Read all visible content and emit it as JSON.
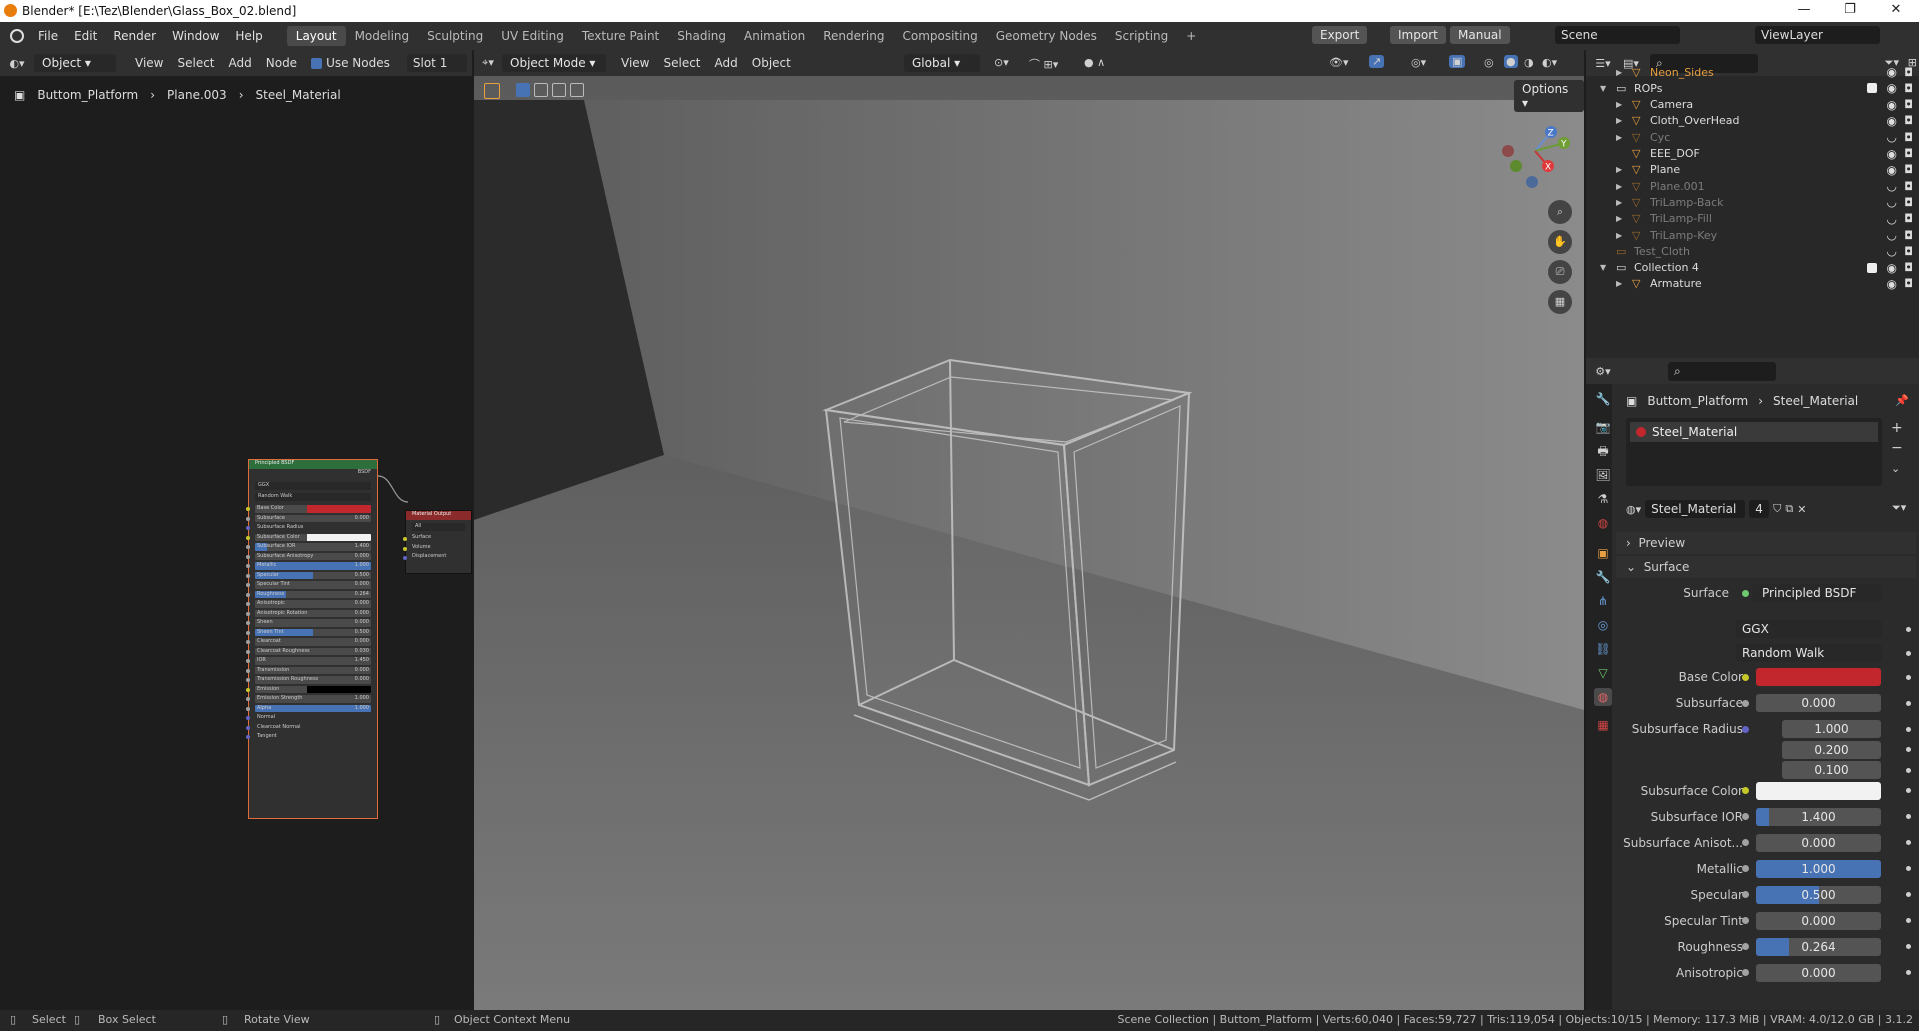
{
  "window": {
    "title": "Blender* [E:\\Tez\\Blender\\Glass_Box_02.blend]",
    "minimize": "—",
    "maximize": "❐",
    "close": "✕"
  },
  "topbar": {
    "menus": [
      "File",
      "Edit",
      "Render",
      "Window",
      "Help"
    ],
    "workspaces": [
      "Layout",
      "Modeling",
      "Sculpting",
      "UV Editing",
      "Texture Paint",
      "Shading",
      "Animation",
      "Rendering",
      "Compositing",
      "Geometry Nodes",
      "Scripting",
      "+"
    ],
    "active_workspace": "Layout",
    "export": "Export",
    "import": "Import",
    "manual": "Manual",
    "scene": "Scene",
    "viewlayer": "ViewLayer"
  },
  "node_editor": {
    "object_mode": "Object",
    "menus": [
      "View",
      "Select",
      "Add",
      "Node"
    ],
    "use_nodes": "Use Nodes",
    "slot": "Slot 1",
    "breadcrumb": [
      "Buttom_Platform",
      "Plane.003",
      "Steel_Material"
    ],
    "principled": {
      "title": "Principled BSDF",
      "out": "BSDF",
      "dist": "GGX",
      "sss": "Random Walk",
      "rows": [
        [
          "Base Color",
          ""
        ],
        [
          "Subsurface",
          "0.000"
        ],
        [
          "Subsurface Radius",
          ""
        ],
        [
          "Subsurface Color",
          ""
        ],
        [
          "Subsurface IOR",
          "1.400"
        ],
        [
          "Subsurface Anisotropy",
          "0.000"
        ],
        [
          "Metallic",
          "1.000"
        ],
        [
          "Specular",
          "0.500"
        ],
        [
          "Specular Tint",
          "0.000"
        ],
        [
          "Roughness",
          "0.264"
        ],
        [
          "Anisotropic",
          "0.000"
        ],
        [
          "Anisotropic Rotation",
          "0.000"
        ],
        [
          "Sheen",
          "0.000"
        ],
        [
          "Sheen Tint",
          "0.500"
        ],
        [
          "Clearcoat",
          "0.000"
        ],
        [
          "Clearcoat Roughness",
          "0.030"
        ],
        [
          "IOR",
          "1.450"
        ],
        [
          "Transmission",
          "0.000"
        ],
        [
          "Transmission Roughness",
          "0.000"
        ],
        [
          "Emission",
          ""
        ],
        [
          "Emission Strength",
          "1.000"
        ],
        [
          "Alpha",
          "1.000"
        ],
        [
          "Normal",
          ""
        ],
        [
          "Clearcoat Normal",
          ""
        ],
        [
          "Tangent",
          ""
        ]
      ]
    },
    "output": {
      "title": "Material Output",
      "target": "All",
      "inputs": [
        "Surface",
        "Volume",
        "Displacement"
      ]
    }
  },
  "viewport": {
    "mode": "Object Mode",
    "menus": [
      "View",
      "Select",
      "Add",
      "Object"
    ],
    "transform": "Global",
    "options": "Options",
    "gizmo": {
      "z": "Z",
      "y": "Y",
      "x": "X"
    }
  },
  "outliner": {
    "items": [
      {
        "name": "Neon_Sides",
        "dim": false,
        "level": 2,
        "accent": "#e8a040"
      },
      {
        "name": "ROPs",
        "dim": false,
        "level": 1,
        "accent": ""
      },
      {
        "name": "Camera",
        "dim": false,
        "level": 2,
        "accent": ""
      },
      {
        "name": "Cloth_OverHead",
        "dim": false,
        "level": 2,
        "accent": ""
      },
      {
        "name": "Cyc",
        "dim": true,
        "level": 2,
        "accent": ""
      },
      {
        "name": "EEE_DOF",
        "dim": false,
        "level": 2,
        "accent": ""
      },
      {
        "name": "Plane",
        "dim": false,
        "level": 2,
        "accent": ""
      },
      {
        "name": "Plane.001",
        "dim": true,
        "level": 2,
        "accent": ""
      },
      {
        "name": "TriLamp-Back",
        "dim": true,
        "level": 2,
        "accent": ""
      },
      {
        "name": "TriLamp-Fill",
        "dim": true,
        "level": 2,
        "accent": ""
      },
      {
        "name": "TriLamp-Key",
        "dim": true,
        "level": 2,
        "accent": ""
      },
      {
        "name": "Test_Cloth",
        "dim": true,
        "level": 1,
        "accent": ""
      },
      {
        "name": "Collection 4",
        "dim": false,
        "level": 1,
        "accent": ""
      },
      {
        "name": "Armature",
        "dim": false,
        "level": 2,
        "accent": ""
      }
    ]
  },
  "properties": {
    "breadcrumb": [
      "Buttom_Platform",
      "Steel_Material"
    ],
    "slot_name": "Steel_Material",
    "material_name": "Steel_Material",
    "users": "4",
    "preview": "Preview",
    "surface_header": "Surface",
    "surface_label": "Surface",
    "surface_value": "Principled BSDF",
    "distribution": "GGX",
    "sss_method": "Random Walk",
    "rows": [
      {
        "label": "Base Color",
        "value": "",
        "type": "color",
        "color": "#c1272d",
        "fill": 0
      },
      {
        "label": "Subsurface",
        "value": "0.000",
        "type": "num",
        "fill": 0
      },
      {
        "label": "Subsurface Radius",
        "value": "1.000",
        "type": "num",
        "fill": 0
      },
      {
        "label": "",
        "value": "0.200",
        "type": "num",
        "fill": 0
      },
      {
        "label": "",
        "value": "0.100",
        "type": "num",
        "fill": 0
      },
      {
        "label": "Subsurface Color",
        "value": "",
        "type": "color",
        "color": "#f2f2f2",
        "fill": 0
      },
      {
        "label": "Subsurface IOR",
        "value": "1.400",
        "type": "num",
        "fill": 0.1
      },
      {
        "label": "Subsurface Anisot...",
        "value": "0.000",
        "type": "num",
        "fill": 0
      },
      {
        "label": "Metallic",
        "value": "1.000",
        "type": "num",
        "fill": 1
      },
      {
        "label": "Specular",
        "value": "0.500",
        "type": "num",
        "fill": 0.5
      },
      {
        "label": "Specular Tint",
        "value": "0.000",
        "type": "num",
        "fill": 0
      },
      {
        "label": "Roughness",
        "value": "0.264",
        "type": "num",
        "fill": 0.264
      },
      {
        "label": "Anisotropic",
        "value": "0.000",
        "type": "num",
        "fill": 0
      }
    ]
  },
  "status": {
    "select": "Select",
    "box_select": "Box Select",
    "rotate": "Rotate View",
    "context": "Object Context Menu",
    "stats": "Scene Collection | Buttom_Platform | Verts:60,040 | Faces:59,727 | Tris:119,054 | Objects:10/15 | Memory: 117.3 MiB | VRAM: 4.0/12.0 GB | 3.1.2"
  }
}
